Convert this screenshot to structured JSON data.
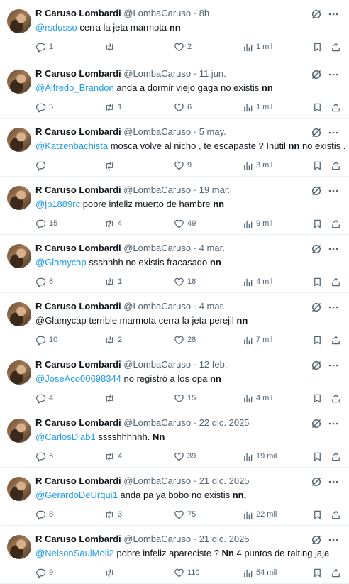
{
  "author": {
    "name": "R Caruso Lombardi",
    "handle": "@LombaCaruso",
    "dot": "·"
  },
  "tweets": [
    {
      "time": "8h",
      "parts": [
        {
          "t": "@rsdusso",
          "s": "mention"
        },
        {
          "t": " cerra la jeta marmota ",
          "s": ""
        },
        {
          "t": "nn",
          "s": "b"
        }
      ],
      "replies": "1",
      "retweets": "",
      "likes": "2",
      "views": "1 mil"
    },
    {
      "time": "11 jun.",
      "parts": [
        {
          "t": "@Alfredo_Brandon",
          "s": "mention"
        },
        {
          "t": " anda a dormir viejo gaga no existis ",
          "s": ""
        },
        {
          "t": "nn",
          "s": "b"
        }
      ],
      "replies": "5",
      "retweets": "1",
      "likes": "6",
      "views": "1 mil"
    },
    {
      "time": "5 may.",
      "parts": [
        {
          "t": "@Katzenbachista",
          "s": "mention"
        },
        {
          "t": " mosca volve al nicho , te escapaste ? Inútil ",
          "s": ""
        },
        {
          "t": "nn",
          "s": "b"
        },
        {
          "t": " no existis .",
          "s": ""
        }
      ],
      "replies": "",
      "retweets": "",
      "likes": "9",
      "views": "3 mil"
    },
    {
      "time": "19 mar.",
      "parts": [
        {
          "t": "@jp1889rc",
          "s": "mention"
        },
        {
          "t": " pobre infeliz muerto de hambre ",
          "s": ""
        },
        {
          "t": "nn",
          "s": "b"
        }
      ],
      "replies": "15",
      "retweets": "4",
      "likes": "49",
      "views": "9 mil"
    },
    {
      "time": "4 mar.",
      "parts": [
        {
          "t": "@Glamycap",
          "s": "mention"
        },
        {
          "t": " ssshhhh no existis fracasado ",
          "s": ""
        },
        {
          "t": "nn",
          "s": "b"
        }
      ],
      "replies": "6",
      "retweets": "1",
      "likes": "18",
      "views": "4 mil"
    },
    {
      "time": "4 mar.",
      "parts": [
        {
          "t": "@Glamycap terrible marmota cerra la jeta perejil ",
          "s": ""
        },
        {
          "t": "nn",
          "s": "b"
        }
      ],
      "replies": "10",
      "retweets": "2",
      "likes": "28",
      "views": "7 mil"
    },
    {
      "time": "12 feb.",
      "parts": [
        {
          "t": "@JoseAco00698344",
          "s": "mention"
        },
        {
          "t": " no registró a los opa ",
          "s": ""
        },
        {
          "t": "nn",
          "s": "b"
        }
      ],
      "replies": "4",
      "retweets": "",
      "likes": "15",
      "views": "4 mil"
    },
    {
      "time": "22 dic. 2025",
      "parts": [
        {
          "t": "@CarlosDiab1",
          "s": "mention"
        },
        {
          "t": " sssshhhhhh.  ",
          "s": ""
        },
        {
          "t": "Nn",
          "s": "b"
        }
      ],
      "replies": "5",
      "retweets": "4",
      "likes": "39",
      "views": "19 mil"
    },
    {
      "time": "21 dic. 2025",
      "parts": [
        {
          "t": "@GerardoDeUrqui1",
          "s": "mention"
        },
        {
          "t": " anda pa ya bobo no existis ",
          "s": ""
        },
        {
          "t": "nn.",
          "s": "b"
        }
      ],
      "replies": "8",
      "retweets": "3",
      "likes": "75",
      "views": "22 mil"
    },
    {
      "time": "21 dic. 2025",
      "parts": [
        {
          "t": "@NelsonSaulMoli2",
          "s": "mention"
        },
        {
          "t": " pobre infeliz apareciste ? ",
          "s": ""
        },
        {
          "t": "Nn",
          "s": "b"
        },
        {
          "t": " 4 puntos de raiting jaja",
          "s": ""
        }
      ],
      "replies": "9",
      "retweets": "",
      "likes": "110",
      "views": "54 mil"
    }
  ],
  "icons": {
    "reply": "reply-icon",
    "retweet": "retweet-icon",
    "like": "like-icon",
    "views": "views-icon",
    "bookmark": "bookmark-icon",
    "share": "share-icon",
    "grok": "grok-icon",
    "more": "more-icon"
  },
  "colors": {
    "mention": "#1d9bf0",
    "muted": "#536471",
    "divider": "#eff3f4"
  }
}
